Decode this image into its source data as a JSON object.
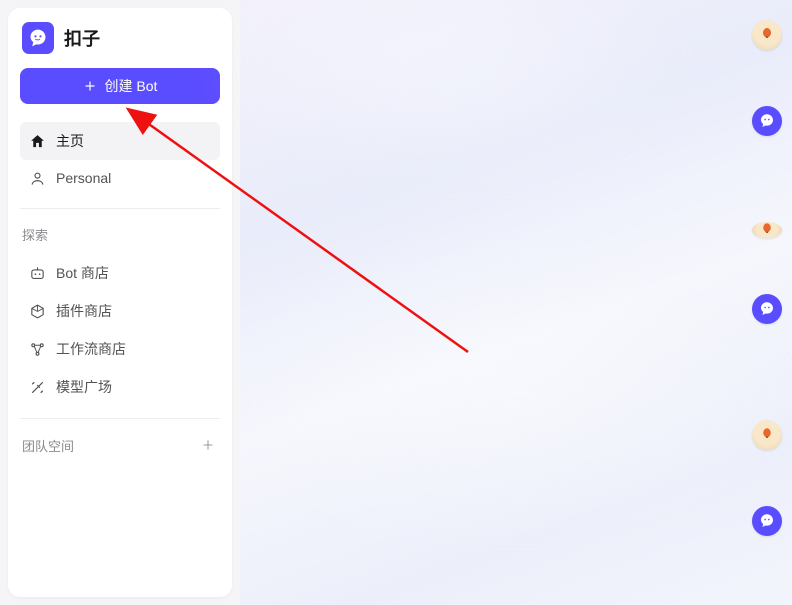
{
  "app": {
    "name": "扣子"
  },
  "sidebar": {
    "create_button": "创建 Bot",
    "primary": [
      {
        "label": "主页",
        "icon": "home-icon",
        "active": true
      },
      {
        "label": "Personal",
        "icon": "person-icon",
        "active": false
      }
    ],
    "explore_header": "探索",
    "explore": [
      {
        "label": "Bot 商店",
        "icon": "bot-store-icon"
      },
      {
        "label": "插件商店",
        "icon": "plugin-store-icon"
      },
      {
        "label": "工作流商店",
        "icon": "workflow-store-icon"
      },
      {
        "label": "模型广场",
        "icon": "model-plaza-icon"
      }
    ],
    "team_space_header": "团队空间"
  },
  "right_rail": {
    "items": [
      {
        "type": "balloon"
      },
      {
        "type": "bot"
      },
      {
        "type": "balloon"
      },
      {
        "type": "bot"
      },
      {
        "type": "balloon"
      },
      {
        "type": "bot"
      }
    ]
  },
  "colors": {
    "accent": "#5a4cff"
  }
}
